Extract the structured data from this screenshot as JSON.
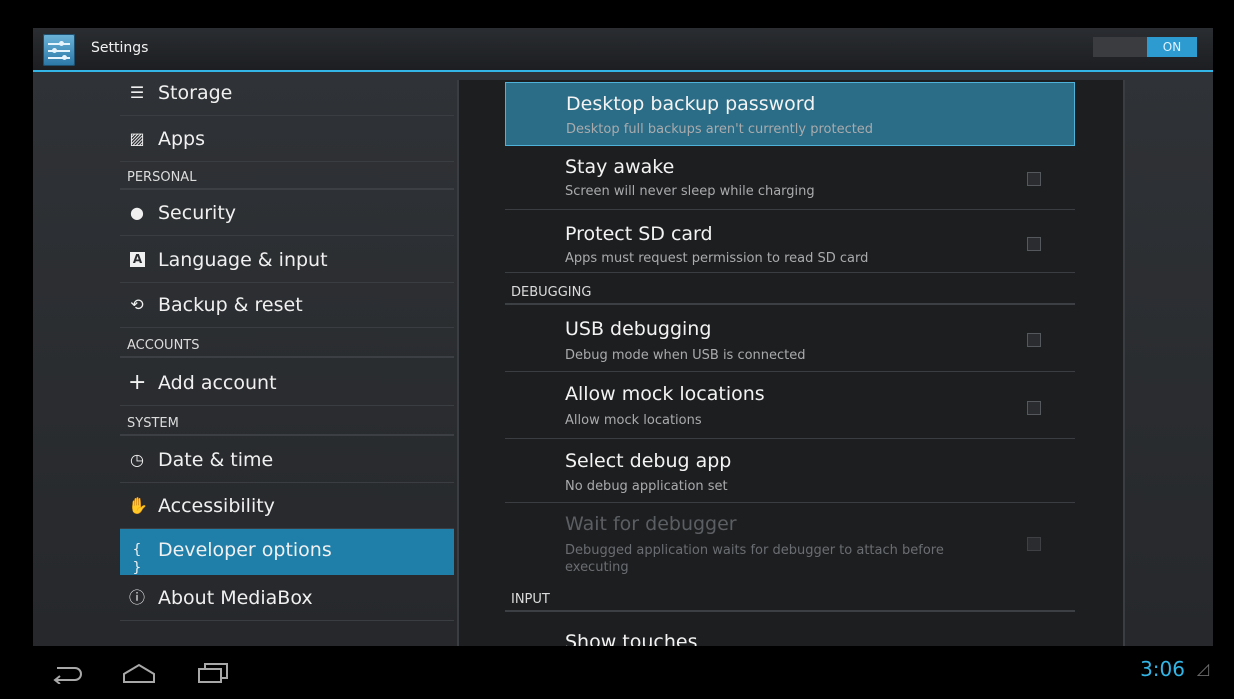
{
  "app": {
    "title": "Settings",
    "toggle_label": "ON"
  },
  "sidebar": {
    "items": [
      {
        "type": "item",
        "icon": "storage-icon",
        "glyph": "☰",
        "label": "Storage"
      },
      {
        "type": "item",
        "icon": "apps-icon",
        "glyph": "▨",
        "label": "Apps"
      },
      {
        "type": "header",
        "label": "PERSONAL"
      },
      {
        "type": "item",
        "icon": "lock-icon",
        "glyph": "🔒",
        "label": "Security"
      },
      {
        "type": "item",
        "icon": "language-icon",
        "glyph": "A",
        "label": "Language & input"
      },
      {
        "type": "item",
        "icon": "backup-icon",
        "glyph": "⟲",
        "label": "Backup & reset"
      },
      {
        "type": "header",
        "label": "ACCOUNTS"
      },
      {
        "type": "item",
        "icon": "plus-icon",
        "glyph": "+",
        "label": "Add account"
      },
      {
        "type": "header",
        "label": "SYSTEM"
      },
      {
        "type": "item",
        "icon": "clock-icon",
        "glyph": "◷",
        "label": "Date & time"
      },
      {
        "type": "item",
        "icon": "hand-icon",
        "glyph": "✋",
        "label": "Accessibility"
      },
      {
        "type": "item",
        "icon": "braces-icon",
        "glyph": "{ }",
        "label": "Developer options",
        "selected": true
      },
      {
        "type": "item",
        "icon": "info-icon",
        "glyph": "ⓘ",
        "label": "About MediaBox"
      }
    ]
  },
  "developer": {
    "prefs": [
      {
        "title": "Desktop backup password",
        "summary": "Desktop full backups aren't currently protected",
        "highlighted": true
      },
      {
        "title": "Stay awake",
        "summary": "Screen will never sleep while charging",
        "checkbox": true,
        "checked": false
      },
      {
        "title": "Protect SD card",
        "summary": "Apps must request permission to read SD card",
        "checkbox": true,
        "checked": false
      }
    ],
    "sections": {
      "debugging": "DEBUGGING",
      "input": "INPUT"
    },
    "debug_prefs": [
      {
        "title": "USB debugging",
        "summary": "Debug mode when USB is connected",
        "checkbox": true,
        "checked": false
      },
      {
        "title": "Allow mock locations",
        "summary": "Allow mock locations",
        "checkbox": true,
        "checked": false
      },
      {
        "title": "Select debug app",
        "summary": "No debug application set"
      },
      {
        "title": "Wait for debugger",
        "summary": "Debugged application waits for debugger to attach before executing",
        "checkbox": true,
        "checked": false,
        "disabled": true
      }
    ],
    "input_prefs": [
      {
        "title": "Show touches"
      }
    ]
  },
  "status_bar": {
    "time": "3:06"
  },
  "nav_icons": [
    "back-icon",
    "home-icon",
    "recent-apps-icon",
    "signal-icon"
  ]
}
